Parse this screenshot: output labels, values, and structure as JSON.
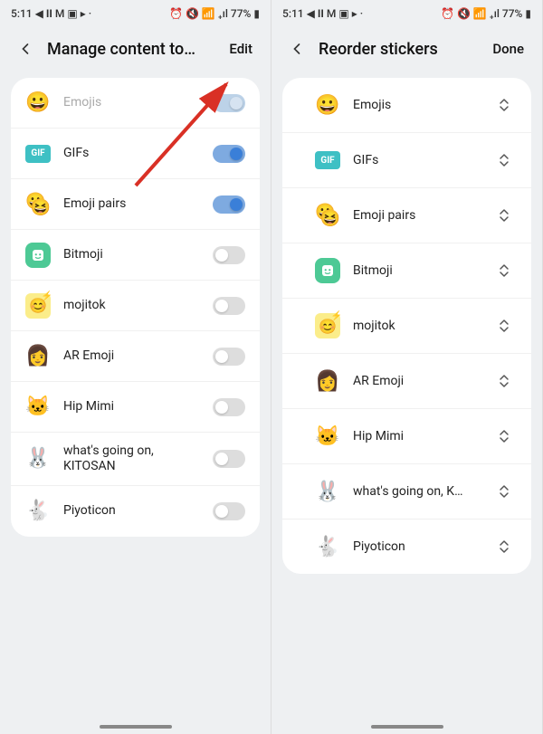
{
  "status": {
    "time": "5:11",
    "battery": "77%"
  },
  "left": {
    "title": "Manage content to…",
    "action": "Edit",
    "items": [
      {
        "label": "Emojis",
        "state": "on-disabled",
        "disabled": true
      },
      {
        "label": "GIFs",
        "state": "on"
      },
      {
        "label": "Emoji pairs",
        "state": "on"
      },
      {
        "label": "Bitmoji",
        "state": "off"
      },
      {
        "label": "mojitok",
        "state": "off"
      },
      {
        "label": "AR Emoji",
        "state": "off"
      },
      {
        "label": "Hip Mimi",
        "state": "off"
      },
      {
        "label": "what's going on, KITOSAN",
        "state": "off"
      },
      {
        "label": "Piyoticon",
        "state": "off"
      }
    ]
  },
  "right": {
    "title": "Reorder stickers",
    "action": "Done",
    "items": [
      {
        "label": "Emojis"
      },
      {
        "label": "GIFs"
      },
      {
        "label": "Emoji pairs"
      },
      {
        "label": "Bitmoji"
      },
      {
        "label": "mojitok"
      },
      {
        "label": "AR Emoji"
      },
      {
        "label": "Hip Mimi"
      },
      {
        "label": "what's going on, K…"
      },
      {
        "label": "Piyoticon"
      }
    ]
  }
}
